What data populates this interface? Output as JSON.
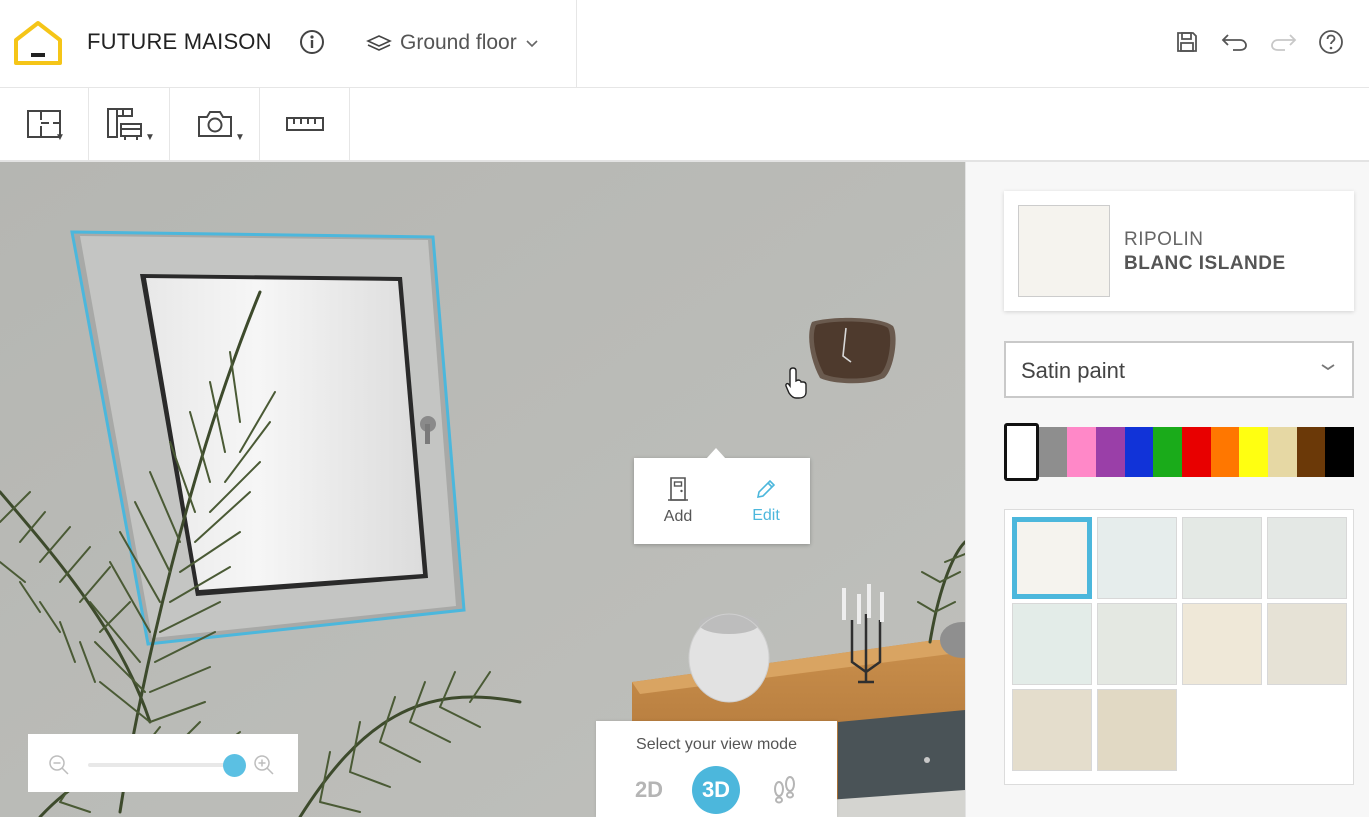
{
  "header": {
    "project_title": "FUTURE MAISON",
    "floor_label": "Ground floor"
  },
  "context_menu": {
    "add_label": "Add",
    "edit_label": "Edit"
  },
  "viewmode": {
    "title": "Select your view mode",
    "mode_2d": "2D",
    "mode_3d": "3D",
    "active": "3D"
  },
  "zoom": {
    "level_fraction": 0.92
  },
  "paint": {
    "brand": "RIPOLIN",
    "color_name": "BLANC ISLANDE",
    "finish": "Satin paint",
    "selected_color": "#f5f3ee"
  },
  "color_families": [
    "#ffffff",
    "#8e8e8e",
    "#ff88c8",
    "#9a3fa8",
    "#1133d8",
    "#1aab1a",
    "#e80000",
    "#ff7700",
    "#ffff11",
    "#e6d8a4",
    "#6b3908",
    "#000000"
  ],
  "shades": [
    "#f5f3ee",
    "#e6edec",
    "#e4e9e5",
    "#e4e8e5",
    "#e3ece8",
    "#e4e8e2",
    "#efe8d8",
    "#e6e2d6",
    "#e4ddcc",
    "#e1d9c4"
  ],
  "accent": "#4cb7dc",
  "logo_color": "#f5c518"
}
